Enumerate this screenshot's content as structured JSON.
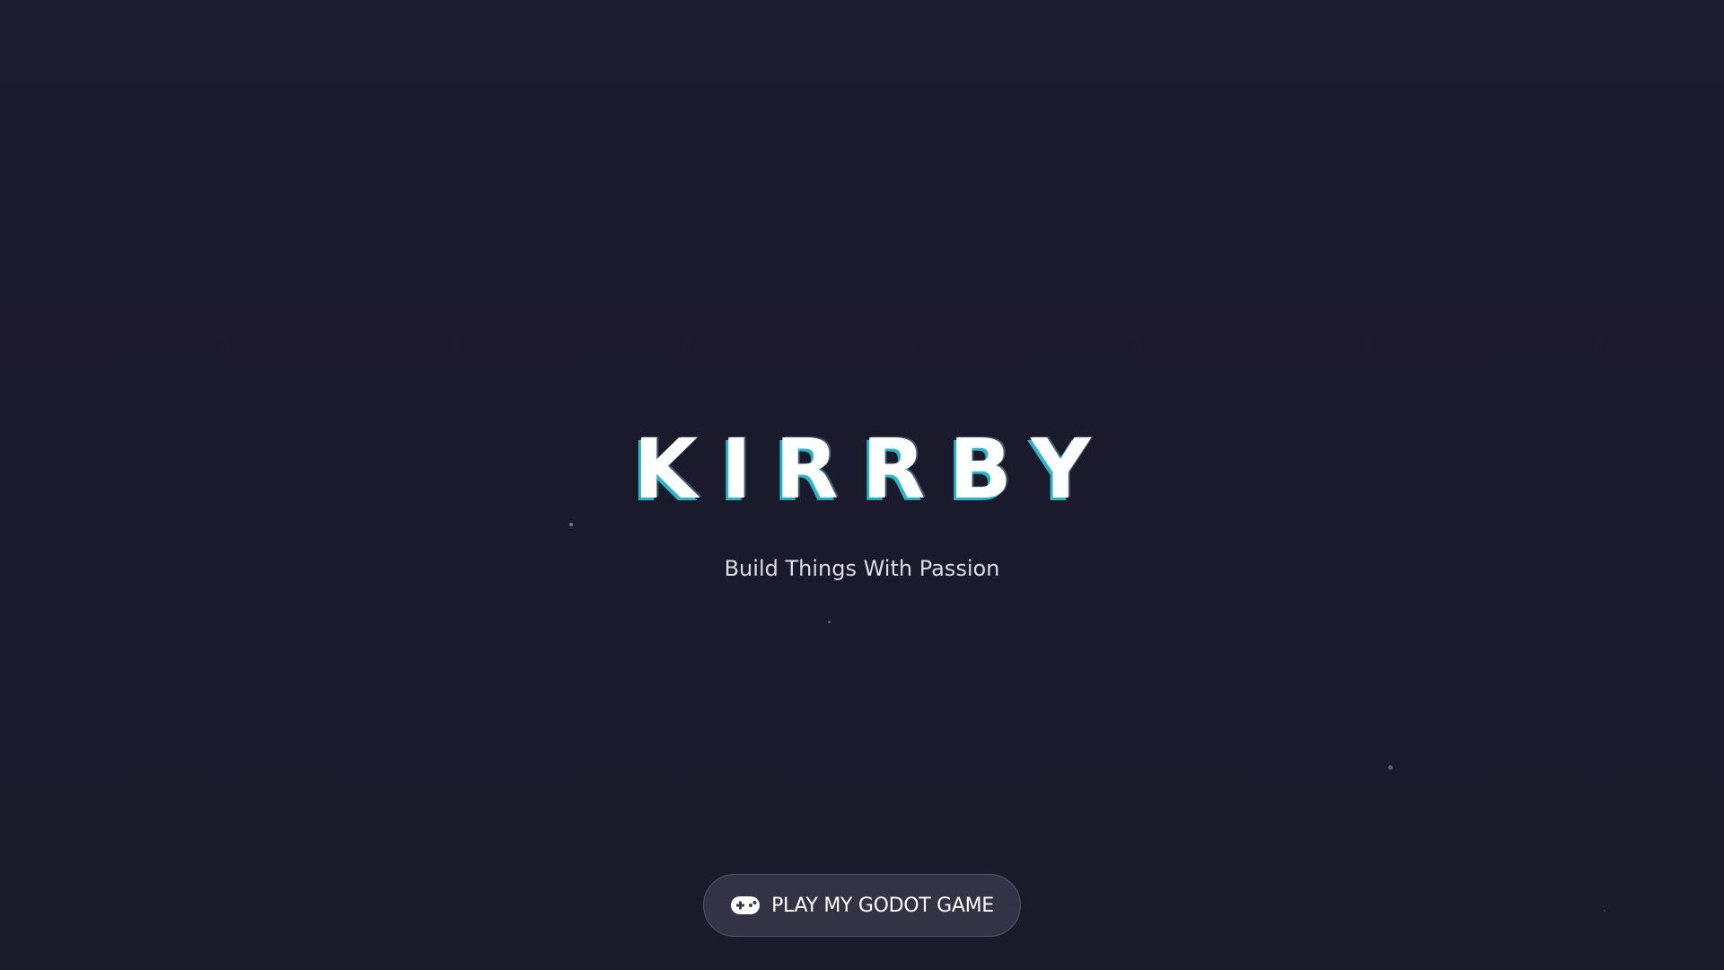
{
  "hero": {
    "title": "KIRRBY",
    "tagline": "Build Things With Passion"
  },
  "cta": {
    "label": "PLAY MY GODOT GAME",
    "icon": "gamepad-icon"
  },
  "colors": {
    "background": "#1c1b2d",
    "title": "#ffffff",
    "title_shadow": "#2bb5c8",
    "tagline": "#dcdbe6",
    "button_bg": "#3a384b",
    "button_border": "#55536a"
  }
}
